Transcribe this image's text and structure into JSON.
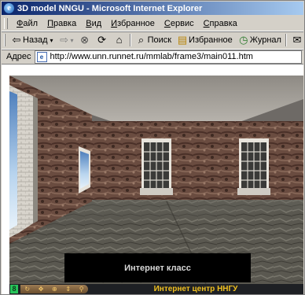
{
  "window": {
    "title": "3D model NNGU - Microsoft Internet Explorer"
  },
  "menu": {
    "items": [
      "Файл",
      "Правка",
      "Вид",
      "Избранное",
      "Сервис",
      "Справка"
    ]
  },
  "toolbar": {
    "back_label": "Назад",
    "search_label": "Поиск",
    "favorites_label": "Избранное",
    "history_label": "Журнал",
    "icons": [
      "back-arrow-icon",
      "forward-arrow-icon",
      "stop-icon",
      "refresh-icon",
      "home-icon",
      "search-icon",
      "favorites-icon",
      "history-icon",
      "mail-icon",
      "print-icon"
    ]
  },
  "address": {
    "label": "Адрес",
    "url": "http://www.unn.runnet.ru/mmlab/frame3/main011.htm"
  },
  "scene": {
    "label": "Интернет класс",
    "status_text": "Интернет центр ННГУ"
  },
  "colors": {
    "title_start": "#0a246a",
    "title_end": "#a6caf0",
    "status_text": "#f0c020",
    "chrome": "#d4d0c8"
  }
}
